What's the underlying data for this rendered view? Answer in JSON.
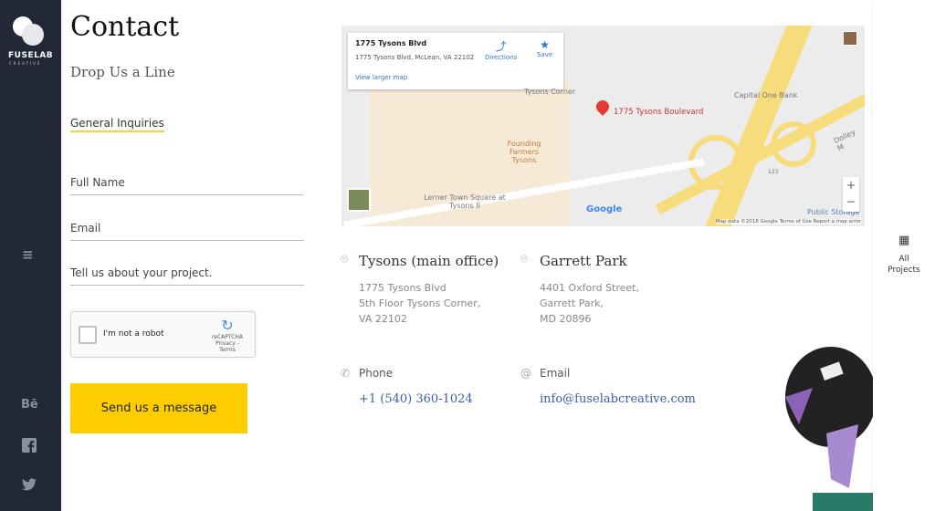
{
  "sidebar": {
    "logo_text": "FUSELAB",
    "logo_sub": "CREATIVE",
    "icons": [
      "menu-icon",
      "behance-icon",
      "facebook-icon",
      "twitter-icon"
    ],
    "behance_glyph": "Bē"
  },
  "right_panel": {
    "label_1": "All",
    "label_2": "Projects",
    "icon": "grid-icon"
  },
  "header": {
    "title": "Contact",
    "subtitle": "Drop Us a Line"
  },
  "form": {
    "category": "General Inquiries",
    "fields": [
      {
        "label": "Full Name"
      },
      {
        "label": "Email"
      },
      {
        "label": "Tell us about your project."
      }
    ],
    "captcha_label": "I'm not a robot",
    "captcha_brand": "reCAPTCHA",
    "captcha_links": "Privacy - Terms",
    "submit": "Send us a message"
  },
  "map": {
    "place_title": "1775 Tysons Blvd",
    "place_address": "1775 Tysons Blvd, McLean, VA 22102",
    "directions": "Directions",
    "save": "Save",
    "view_larger": "View larger map",
    "marker_label": "1775 Tysons Boulevard",
    "labels": [
      "Tysons Corner",
      "Founding Farmers Tysons",
      "Lerner Town Square at Tysons II",
      "Capital One Bank",
      "Dolley M",
      "Public Storage",
      "123"
    ],
    "footer": "Map data ©2018 Google   Terms of Use   Report a map error",
    "google": "Google",
    "zoom_in": "+",
    "zoom_out": "−",
    "accent": "#3a74c8"
  },
  "offices": [
    {
      "name": "Tysons (main office)",
      "lines": [
        "1775 Tysons Blvd",
        "5th Floor Tysons Corner,",
        "VA 22102"
      ]
    },
    {
      "name": "Garrett Park",
      "lines": [
        "4401 Oxford Street,",
        "Garrett Park,",
        "MD 20896"
      ]
    }
  ],
  "contact": {
    "phone_label": "Phone",
    "phone": "+1 (540) 360-1024",
    "email_label": "Email",
    "email": "info@fuselabcreative.com"
  },
  "colors": {
    "sidebar": "#232838",
    "button": "#fdcd00",
    "link": "#3a5fa8"
  }
}
